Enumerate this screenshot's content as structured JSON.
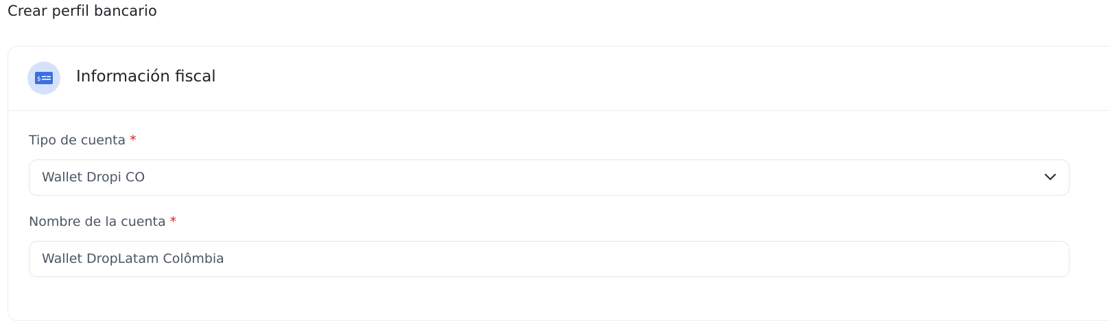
{
  "page": {
    "title": "Crear perfil bancario"
  },
  "section": {
    "title": "Información fiscal",
    "icon": "bank-card-icon",
    "icon_color": "#3b6fe0",
    "icon_bg": "#d6e2fb"
  },
  "form": {
    "account_type": {
      "label": "Tipo de cuenta",
      "required_mark": "*",
      "value": "Wallet Dropi CO"
    },
    "account_name": {
      "label": "Nombre de la cuenta",
      "required_mark": "*",
      "value": "Wallet DropLatam Colômbia"
    }
  },
  "colors": {
    "required": "#e11d1d",
    "border": "#e3e5e9",
    "text": "#4b5563"
  }
}
